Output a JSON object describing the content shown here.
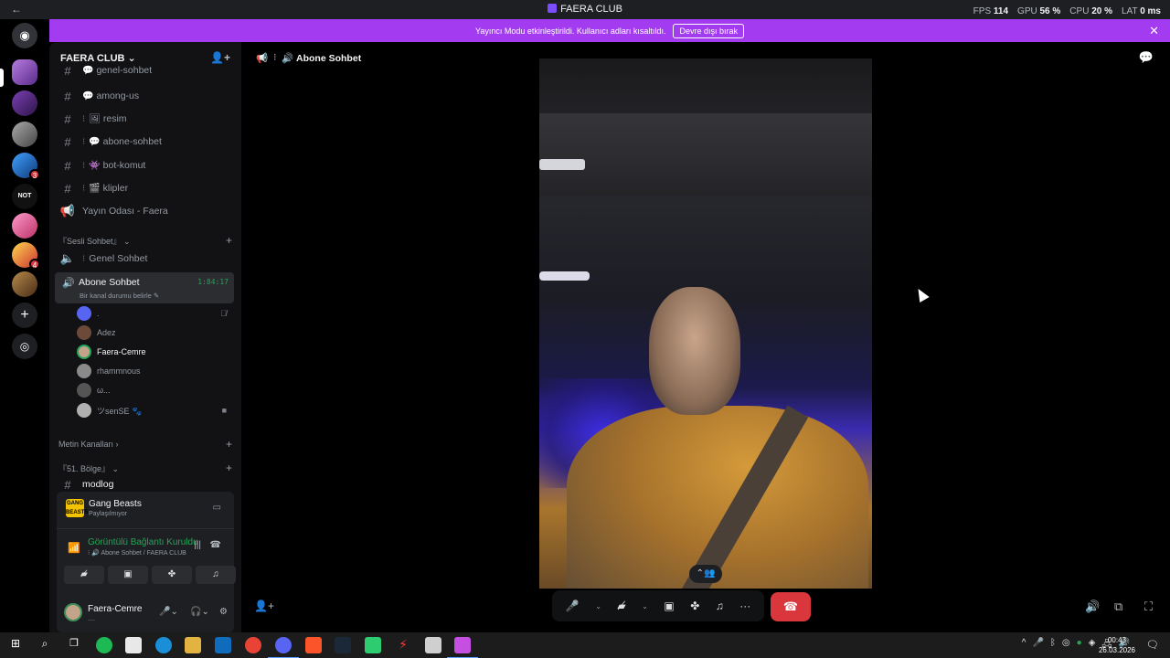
{
  "titlebar": {
    "back_icon": "arrow-left-icon",
    "title": "FAERA CLUB",
    "stats": [
      {
        "label": "FPS",
        "value": "114"
      },
      {
        "label": "GPU",
        "value": "56 %"
      },
      {
        "label": "CPU",
        "value": "20 %"
      },
      {
        "label": "LAT",
        "value": "0 ms"
      }
    ]
  },
  "banner": {
    "text": "Yayıncı Modu etkinleştirildi. Kullanıcı adları kısaltıldı.",
    "button": "Devre dışı bırak",
    "close": "✕"
  },
  "sidebar": {
    "server_name": "FAERA CLUB",
    "text_channels": [
      {
        "name": "genel-sohbet",
        "emoji": "💬"
      },
      {
        "name": "among-us",
        "emoji": "💬"
      },
      {
        "name": "resim",
        "emoji": "🖼"
      },
      {
        "name": "abone-sohbet",
        "emoji": "💬"
      },
      {
        "name": "bot-komut",
        "emoji": "👾"
      },
      {
        "name": "klipler",
        "emoji": "🎬"
      }
    ],
    "stage_channel": "Yayın Odası - Faera",
    "voice_category": "『Sesli Sohbet』",
    "voice_channel_1": "Genel Sohbet",
    "active_voice": {
      "name": "Abone Sohbet",
      "time": "1:84:17",
      "status": "Bir kanal durumu belirle ✎"
    },
    "voice_users": [
      {
        "name": ".",
        "color": "#5865f2",
        "highlight": false
      },
      {
        "name": "Adez",
        "color": "#6b4a3a",
        "highlight": false
      },
      {
        "name": "Faera-Cemre",
        "color": "#c3a48a",
        "highlight": true
      },
      {
        "name": "rhammnous",
        "color": "#8a8a8a",
        "highlight": false
      },
      {
        "name": "ω...",
        "color": "#555",
        "highlight": false
      },
      {
        "name": "ツsenSE 🐾",
        "color": "#b0b0b0",
        "highlight": false
      }
    ],
    "category_text": "Metin Kanalları",
    "category_zone": "『51. Bölge』",
    "modlog": "modlog"
  },
  "activity": {
    "game": "Gang Beasts",
    "status": "Paylaşılmıyor",
    "icon_text": "GANG BEASTS"
  },
  "connection": {
    "title": "Görüntülü Bağlantı Kuruldu",
    "subtitle": "⁝ 🔊 Abone Sohbet / FAERA CLUB"
  },
  "user": {
    "name": "Faera-Cemre",
    "status": "...."
  },
  "main": {
    "channel_title": "🔊 Abone Sohbet"
  },
  "taskbar": {
    "time": "00:43",
    "date": "26.03.2026"
  },
  "colors": {
    "accent_green": "#23a55a",
    "banner_purple": "#a33cf0",
    "hangup_red": "#da373c"
  }
}
